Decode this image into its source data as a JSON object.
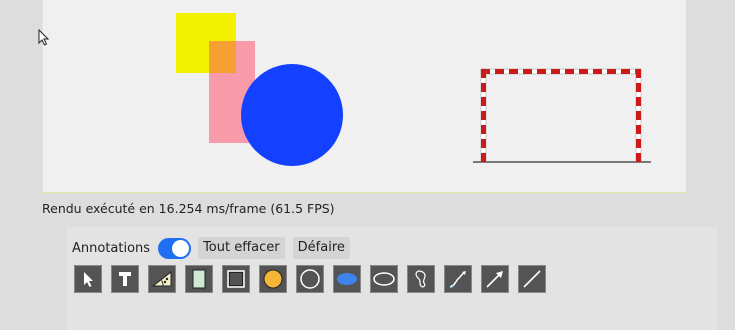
{
  "status": {
    "render_time": "Rendu exécuté en 16.254 ms/frame (61.5 FPS)"
  },
  "annotations": {
    "label": "Annotations",
    "toggle_on": true,
    "clear_all": "Tout effacer",
    "undo": "Défaire"
  },
  "colors": {
    "accent": "#1e6ff2",
    "yellow_square": "#f2f200",
    "pink_rect": "#f79aaa",
    "blue_circle": "#1440ff",
    "goal_red": "#cc1a1a"
  },
  "tools": [
    {
      "name": "select-arrow-icon"
    },
    {
      "name": "text-icon"
    },
    {
      "name": "measure-triangle-icon"
    },
    {
      "name": "filled-rectangle-icon"
    },
    {
      "name": "rectangle-outline-icon"
    },
    {
      "name": "filled-circle-icon"
    },
    {
      "name": "circle-outline-icon"
    },
    {
      "name": "filled-ellipse-icon"
    },
    {
      "name": "ellipse-outline-icon"
    },
    {
      "name": "freehand-icon"
    },
    {
      "name": "curve-arrow-icon"
    },
    {
      "name": "arrow-icon"
    },
    {
      "name": "line-icon"
    }
  ]
}
